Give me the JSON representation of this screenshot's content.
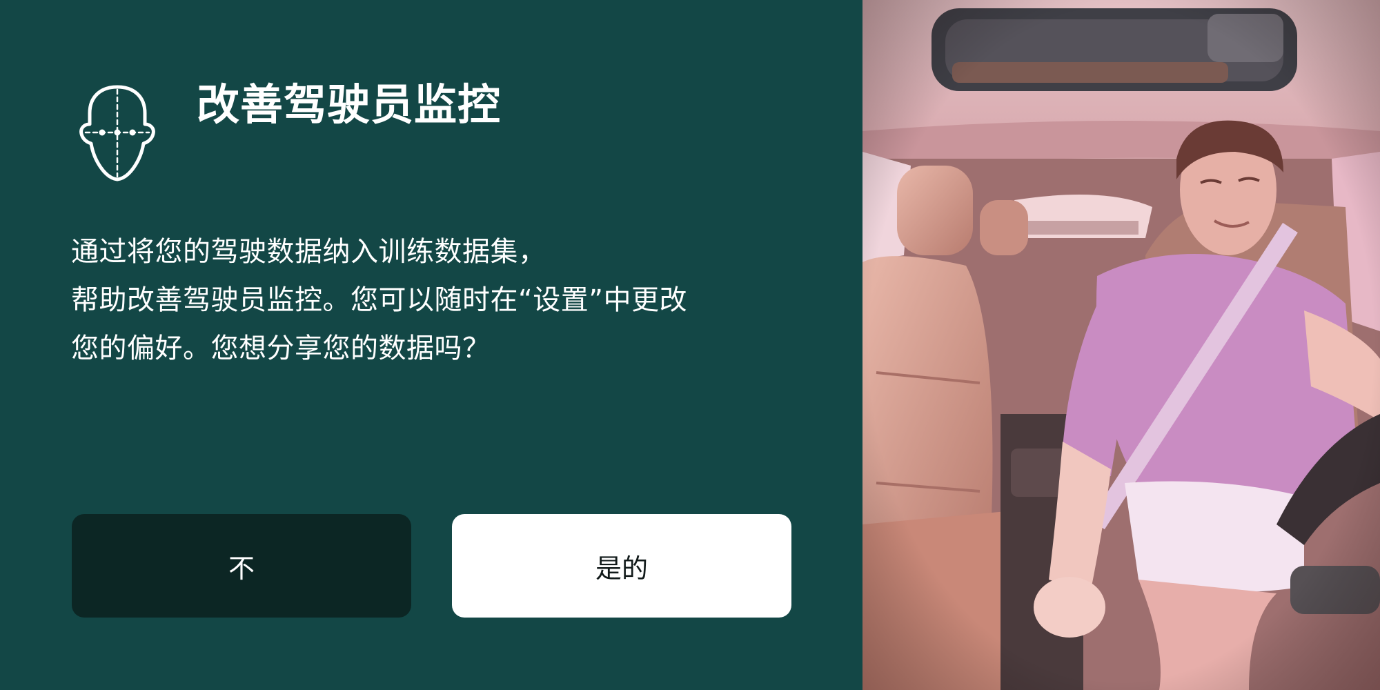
{
  "dialog": {
    "icon": "face-scan-icon",
    "title": "改善驾驶员监控",
    "description_lines": [
      "通过将您的驾驶数据纳入训练数据集，",
      "帮助改善驾驶员监控。您可以随时在“设置”中更改",
      "您的偏好。您想分享您的数据吗？"
    ],
    "buttons": {
      "no_label": "不",
      "yes_label": "是的"
    }
  },
  "camera_feed": {
    "icon": "driver-camera-image"
  },
  "colors": {
    "panel_background": "#134746",
    "no_button": "#0c2624",
    "yes_button": "#ffffff",
    "text": "#ffffff"
  }
}
